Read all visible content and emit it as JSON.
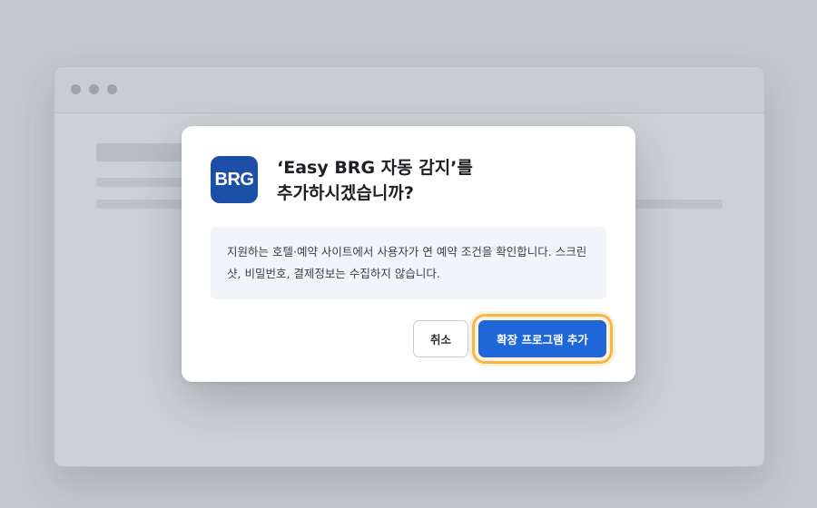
{
  "dialog": {
    "app_icon_text": "BRG",
    "title_line1": "‘Easy BRG 자동 감지’를",
    "title_line2": "추가하시겠습니까?",
    "message": "지원하는 호텔·예약 사이트에서 사용자가 연 예약 조건을 확인합니다. 스크린샷, 비밀번호, 결제정보는 수집하지 않습니다.",
    "cancel_label": "취소",
    "confirm_label": "확장 프로그램 추가"
  },
  "colors": {
    "app_icon_bg": "#1b4fa8",
    "primary_button": "#1f66d9",
    "focus_highlight": "#f3b74a",
    "message_bg": "#f1f4f8",
    "backdrop": "#c4c7cc"
  }
}
